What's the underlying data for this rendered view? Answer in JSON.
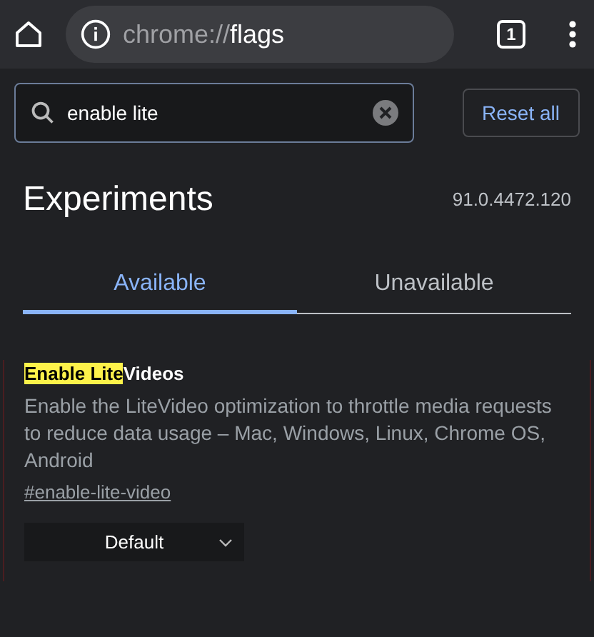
{
  "toolbar": {
    "url_scheme": "chrome://",
    "url_host": "flags",
    "tab_count": "1"
  },
  "search": {
    "value": "enable lite",
    "reset_label": "Reset all"
  },
  "header": {
    "title": "Experiments",
    "version": "91.0.4472.120"
  },
  "tabs": [
    {
      "label": "Available",
      "selected": true
    },
    {
      "label": "Unavailable",
      "selected": false
    }
  ],
  "flags": [
    {
      "title_parts": [
        {
          "text": "Enable Lite",
          "highlighted": true
        },
        {
          "text": "Videos",
          "highlighted": false
        }
      ],
      "description": "Enable the LiteVideo optimization to throttle media requests to reduce data usage – Mac, Windows, Linux, Chrome OS, Android",
      "link": "#enable-lite-video",
      "value": "Default"
    }
  ]
}
